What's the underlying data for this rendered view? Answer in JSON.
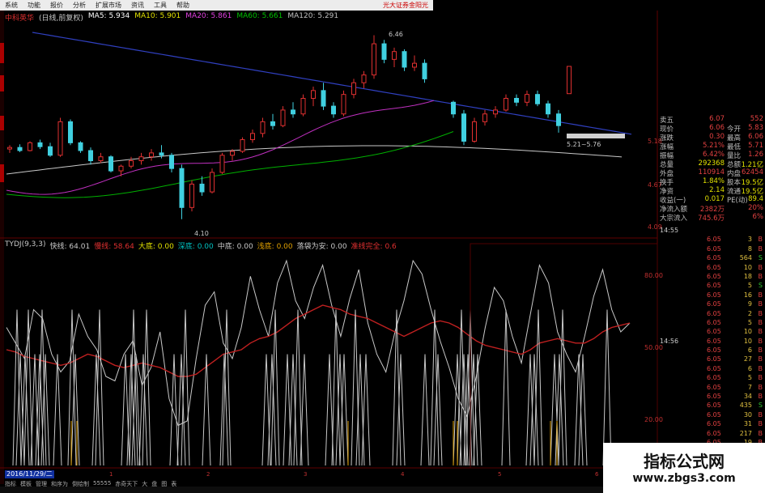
{
  "menu": {
    "items": [
      "系统",
      "功能",
      "报价",
      "分析",
      "扩展市场",
      "资讯",
      "工具",
      "帮助"
    ],
    "brand": "光大证券金阳光"
  },
  "title": {
    "stock": "中科英华",
    "period": "(日线,前复权)",
    "ma": [
      {
        "label": "MA5: 5.934",
        "color": "#ffffff"
      },
      {
        "label": "MA10: 5.901",
        "color": "#e0e000"
      },
      {
        "label": "MA20: 5.861",
        "color": "#e040e0"
      },
      {
        "label": "MA60: 5.661",
        "color": "#00c000"
      },
      {
        "label": "MA120: 5.291",
        "color": "#c0c0c0"
      }
    ]
  },
  "price_axis": [
    "5.18",
    "4.67",
    "4.09"
  ],
  "price_annotations": {
    "high": "6.46",
    "low": "4.10",
    "mid": "5.21~5.76"
  },
  "indicator": {
    "name": "TYDJ(9,3,3)",
    "items": [
      {
        "label": "快线: 64.01",
        "color": "#c8c8c8"
      },
      {
        "label": "慢线: 58.64",
        "color": "#e03030"
      },
      {
        "label": "大底: 0.00",
        "color": "#e0e000"
      },
      {
        "label": "深底: 0.00",
        "color": "#00c0c0"
      },
      {
        "label": "中底: 0.00",
        "color": "#c8c8c8"
      },
      {
        "label": "浅底: 0.00",
        "color": "#e0a000"
      },
      {
        "label": "落袋为安: 0.00",
        "color": "#c8c8c8"
      },
      {
        "label": "准线完全: 0.6",
        "color": "#e03030"
      }
    ],
    "axis": [
      "80.00",
      "50.00",
      "20.00"
    ]
  },
  "quote_panel": {
    "rows": [
      {
        "l1": "卖五",
        "v1": "6.07",
        "l2": "",
        "v2": "552",
        "c": "#e04040"
      },
      {
        "l1": "现价",
        "v1": "6.06",
        "l2": "今开",
        "v2": "5.83",
        "c": "#e04040"
      },
      {
        "l1": "涨跌",
        "v1": "0.30",
        "l2": "最高",
        "v2": "6.06",
        "c": "#e04040"
      },
      {
        "l1": "涨幅",
        "v1": "5.21%",
        "l2": "最低",
        "v2": "5.71",
        "c": "#e04040"
      },
      {
        "l1": "振幅",
        "v1": "6.42%",
        "l2": "量比",
        "v2": "1.26",
        "c": "#e04040"
      },
      {
        "l1": "总量",
        "v1": "292368",
        "l2": "总额",
        "v2": "1.21亿",
        "c": "#e0e000"
      },
      {
        "l1": "外盘",
        "v1": "110914",
        "l2": "内盘",
        "v2": "62454",
        "c": "#e04040"
      },
      {
        "l1": "换手",
        "v1": "1.84%",
        "l2": "股本",
        "v2": "19.5亿",
        "c": "#e0e000"
      },
      {
        "l1": "净资",
        "v1": "2.14",
        "l2": "流通",
        "v2": "19.5亿",
        "c": "#e0e000"
      },
      {
        "l1": "收益(一)",
        "v1": "0.017",
        "l2": "PE(动)",
        "v2": "89.4",
        "c": "#e0e000"
      },
      {
        "l1": "净流入额",
        "v1": "2382万",
        "l2": "",
        "v2": "20%",
        "c": "#e04040"
      },
      {
        "l1": "大宗流入",
        "v1": "745.6万",
        "l2": "",
        "v2": "6%",
        "c": "#e04040"
      }
    ]
  },
  "ticks": [
    {
      "t": "14:55",
      "p": "",
      "v": "",
      "b": ""
    },
    {
      "t": "",
      "p": "6.05",
      "v": "3",
      "b": "B"
    },
    {
      "t": "",
      "p": "6.05",
      "v": "8",
      "b": "B"
    },
    {
      "t": "",
      "p": "6.05",
      "v": "564",
      "b": "S"
    },
    {
      "t": "",
      "p": "6.05",
      "v": "10",
      "b": "B"
    },
    {
      "t": "",
      "p": "6.05",
      "v": "18",
      "b": "B"
    },
    {
      "t": "",
      "p": "6.05",
      "v": "5",
      "b": "S"
    },
    {
      "t": "",
      "p": "6.05",
      "v": "16",
      "b": "B"
    },
    {
      "t": "",
      "p": "6.05",
      "v": "9",
      "b": "B"
    },
    {
      "t": "",
      "p": "6.05",
      "v": "2",
      "b": "B"
    },
    {
      "t": "",
      "p": "6.05",
      "v": "5",
      "b": "B"
    },
    {
      "t": "",
      "p": "6.05",
      "v": "10",
      "b": "B"
    },
    {
      "t": "14:56",
      "p": "6.05",
      "v": "10",
      "b": "B"
    },
    {
      "t": "",
      "p": "6.05",
      "v": "6",
      "b": "B"
    },
    {
      "t": "",
      "p": "6.05",
      "v": "27",
      "b": "B"
    },
    {
      "t": "",
      "p": "6.05",
      "v": "6",
      "b": "B"
    },
    {
      "t": "",
      "p": "6.05",
      "v": "5",
      "b": "B"
    },
    {
      "t": "",
      "p": "6.05",
      "v": "7",
      "b": "B"
    },
    {
      "t": "",
      "p": "6.05",
      "v": "34",
      "b": "B"
    },
    {
      "t": "",
      "p": "6.05",
      "v": "435",
      "b": "S"
    },
    {
      "t": "",
      "p": "6.05",
      "v": "30",
      "b": "B"
    },
    {
      "t": "",
      "p": "6.05",
      "v": "31",
      "b": "B"
    },
    {
      "t": "",
      "p": "6.05",
      "v": "217",
      "b": "B"
    },
    {
      "t": "",
      "p": "6.05",
      "v": "19",
      "b": "B"
    },
    {
      "t": "",
      "p": "6.05",
      "v": "24",
      "b": "B"
    }
  ],
  "bottom": {
    "date": "2016/11/29/二",
    "tabs": [
      "指标",
      "模板",
      "管理",
      "和序为",
      "倒绘制",
      "55555",
      "赤奇天下",
      "大",
      "盘",
      "图",
      "表"
    ],
    "xticks": [
      "1",
      "2",
      "3",
      "4",
      "5",
      "6"
    ]
  },
  "watermark": {
    "line1": "指标公式网",
    "line2": "www.zbgs3.com"
  },
  "series": {
    "candles": [
      [
        5.0,
        5.05,
        4.95,
        5.02
      ],
      [
        5.02,
        5.06,
        4.96,
        4.98
      ],
      [
        4.98,
        5.1,
        4.97,
        5.08
      ],
      [
        5.08,
        5.12,
        5.0,
        5.03
      ],
      [
        5.03,
        5.08,
        4.9,
        4.92
      ],
      [
        4.92,
        5.4,
        4.9,
        5.35
      ],
      [
        5.35,
        5.38,
        5.05,
        5.08
      ],
      [
        5.08,
        5.1,
        4.95,
        4.98
      ],
      [
        4.98,
        5.02,
        4.8,
        4.85
      ],
      [
        4.85,
        4.95,
        4.82,
        4.9
      ],
      [
        4.9,
        4.92,
        4.7,
        4.72
      ],
      [
        4.72,
        4.8,
        4.65,
        4.78
      ],
      [
        4.78,
        4.9,
        4.75,
        4.85
      ],
      [
        4.85,
        4.95,
        4.8,
        4.9
      ],
      [
        4.9,
        5.0,
        4.85,
        4.95
      ],
      [
        4.95,
        5.05,
        4.88,
        4.92
      ],
      [
        4.92,
        4.95,
        4.7,
        4.75
      ],
      [
        4.75,
        4.8,
        4.1,
        4.25
      ],
      [
        4.25,
        4.6,
        4.2,
        4.55
      ],
      [
        4.55,
        4.65,
        4.4,
        4.45
      ],
      [
        4.45,
        4.75,
        4.43,
        4.7
      ],
      [
        4.7,
        4.95,
        4.68,
        4.92
      ],
      [
        4.92,
        5.0,
        4.85,
        4.97
      ],
      [
        4.97,
        5.15,
        4.95,
        5.12
      ],
      [
        5.12,
        5.25,
        5.08,
        5.2
      ],
      [
        5.2,
        5.4,
        5.15,
        5.35
      ],
      [
        5.35,
        5.45,
        5.25,
        5.3
      ],
      [
        5.3,
        5.55,
        5.28,
        5.5
      ],
      [
        5.5,
        5.6,
        5.4,
        5.45
      ],
      [
        5.45,
        5.7,
        5.42,
        5.65
      ],
      [
        5.65,
        5.8,
        5.55,
        5.75
      ],
      [
        5.75,
        5.85,
        5.5,
        5.55
      ],
      [
        5.55,
        5.6,
        5.4,
        5.45
      ],
      [
        5.45,
        5.75,
        5.42,
        5.7
      ],
      [
        5.7,
        5.9,
        5.65,
        5.85
      ],
      [
        5.85,
        6.0,
        5.78,
        5.95
      ],
      [
        5.95,
        6.46,
        5.9,
        6.35
      ],
      [
        6.35,
        6.4,
        6.1,
        6.15
      ],
      [
        6.15,
        6.3,
        6.05,
        6.25
      ],
      [
        6.25,
        6.28,
        6.0,
        6.05
      ],
      [
        6.05,
        6.2,
        6.0,
        6.1
      ],
      [
        6.1,
        6.15,
        5.85,
        5.9
      ]
    ],
    "candles2": [
      [
        5.6,
        5.62,
        5.4,
        5.45
      ],
      [
        5.45,
        5.5,
        5.05,
        5.1
      ],
      [
        5.1,
        5.4,
        5.08,
        5.35
      ],
      [
        5.35,
        5.5,
        5.3,
        5.45
      ],
      [
        5.45,
        5.55,
        5.4,
        5.5
      ],
      [
        5.5,
        5.7,
        5.48,
        5.65
      ],
      [
        5.65,
        5.7,
        5.55,
        5.6
      ],
      [
        5.6,
        5.75,
        5.55,
        5.7
      ],
      [
        5.7,
        5.75,
        5.55,
        5.58
      ],
      [
        5.58,
        5.62,
        5.4,
        5.45
      ],
      [
        5.45,
        5.5,
        5.21,
        5.3
      ],
      [
        5.71,
        6.06,
        5.71,
        6.06
      ]
    ],
    "fast": [
      62,
      55,
      48,
      70,
      66,
      50,
      42,
      47,
      68,
      58,
      52,
      40,
      38,
      50,
      56,
      36,
      44,
      60,
      30,
      18,
      20,
      48,
      72,
      78,
      55,
      48,
      62,
      85,
      70,
      58,
      82,
      92,
      74,
      66,
      80,
      90,
      72,
      58,
      75,
      88,
      64,
      50,
      42,
      60,
      74,
      92,
      86,
      70,
      56,
      44,
      30,
      22,
      40,
      62,
      80,
      74,
      58,
      46,
      68,
      90,
      82,
      60,
      50,
      42,
      58,
      76,
      88,
      70,
      60,
      64
    ],
    "slow": [
      52,
      51,
      49,
      48,
      47,
      46,
      45,
      46,
      48,
      50,
      49,
      47,
      45,
      44,
      45,
      46,
      45,
      44,
      42,
      40,
      40,
      41,
      44,
      47,
      50,
      51,
      52,
      55,
      57,
      58,
      60,
      63,
      66,
      68,
      70,
      72,
      71,
      70,
      68,
      67,
      66,
      64,
      62,
      60,
      58,
      60,
      62,
      64,
      65,
      64,
      62,
      59,
      56,
      54,
      53,
      52,
      51,
      50,
      52,
      55,
      56,
      57,
      56,
      55,
      55,
      57,
      60,
      62,
      63,
      64
    ],
    "spikes": [
      16,
      20,
      26,
      30,
      38,
      44,
      47,
      51,
      66,
      84,
      88,
      114,
      118,
      150,
      157,
      160,
      163,
      172,
      176,
      210,
      219,
      224,
      250,
      272,
      275,
      324,
      331,
      335,
      350,
      357,
      363,
      371,
      402,
      410,
      415,
      420,
      434,
      440,
      447,
      485,
      490,
      520,
      532,
      536,
      560,
      565,
      568,
      573,
      576,
      580,
      585,
      620,
      650,
      655,
      660,
      680,
      686,
      690,
      710,
      715,
      745
    ]
  }
}
